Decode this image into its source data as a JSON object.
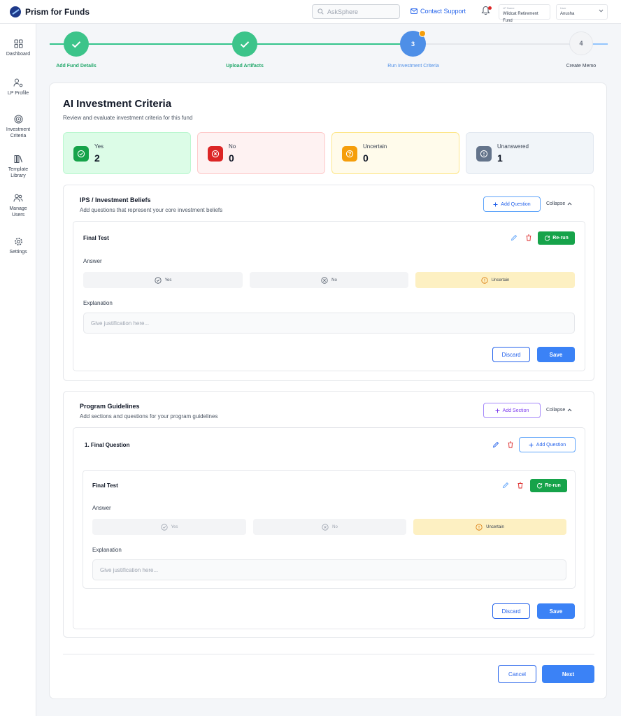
{
  "app": {
    "name": "Prism for Funds"
  },
  "header": {
    "search_placeholder": "AskSphere",
    "contact_label": "Contact Support",
    "lp_label": "LP Name",
    "lp_value": "Wildcat Retirement Fund",
    "user_label": "User",
    "user_value": "Anusha"
  },
  "sidebar": {
    "items": [
      {
        "label": "Dashboard",
        "icon": "grid-icon"
      },
      {
        "label": "LP Profile",
        "icon": "user-gear-icon"
      },
      {
        "label": "Investment Criteria",
        "icon": "target-icon"
      },
      {
        "label": "Template Library",
        "icon": "books-icon"
      },
      {
        "label": "Manage Users",
        "icon": "users-icon"
      },
      {
        "label": "Settings",
        "icon": "gear-icon"
      }
    ]
  },
  "stepper": {
    "steps": [
      {
        "label": "Add Fund Details",
        "state": "done"
      },
      {
        "label": "Upload Artifacts",
        "state": "done"
      },
      {
        "label": "Run Investment Criteria",
        "number": "3",
        "state": "current"
      },
      {
        "label": "Create Memo",
        "number": "4",
        "state": "pending"
      }
    ]
  },
  "main": {
    "title": "AI Investment Criteria",
    "subtitle": "Review and evaluate investment criteria for this fund",
    "stats": [
      {
        "label": "Yes",
        "value": "2",
        "color": "#16a34a"
      },
      {
        "label": "No",
        "value": "0",
        "color": "#dc2626"
      },
      {
        "label": "Uncertain",
        "value": "0",
        "color": "#f59e0b"
      },
      {
        "label": "Unanswered",
        "value": "1",
        "color": "#64748b"
      }
    ]
  },
  "ips": {
    "title": "IPS / Investment Beliefs",
    "subtitle": "Add questions that represent your core investment beliefs",
    "add_label": "Add Question",
    "collapse_label": "Collapse",
    "question": {
      "title": "Final Test",
      "rerun_label": "Re-run",
      "answer_label": "Answer",
      "options": [
        "Yes",
        "No",
        "Uncertain"
      ],
      "selected": "Uncertain",
      "explanation_label": "Explanation",
      "explanation_placeholder": "Give justification here...",
      "discard_label": "Discard",
      "save_label": "Save"
    }
  },
  "program": {
    "title": "Program Guidelines",
    "subtitle": "Add sections and questions for your program guidelines",
    "add_label": "Add Section",
    "collapse_label": "Collapse",
    "subsection": {
      "title": "1. Final Question",
      "add_label": "Add Question"
    },
    "question": {
      "title": "Final Test",
      "rerun_label": "Re-run",
      "answer_label": "Answer",
      "options": [
        "Yes",
        "No",
        "Uncertain"
      ],
      "selected": "Uncertain",
      "explanation_label": "Explanation",
      "explanation_placeholder": "Give justification here...",
      "discard_label": "Discard",
      "save_label": "Save"
    }
  },
  "footer": {
    "cancel_label": "Cancel",
    "next_label": "Next"
  }
}
